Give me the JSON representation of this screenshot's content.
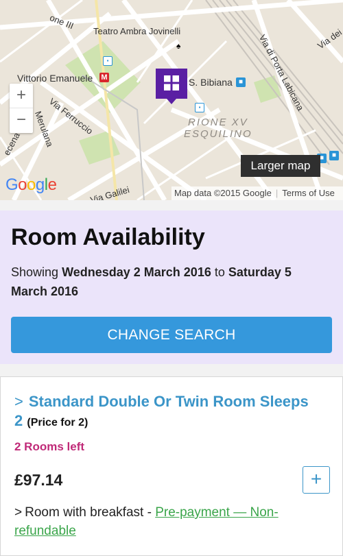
{
  "map": {
    "labels": {
      "teatro": "Teatro Ambra Jovinelli",
      "vittorio": "Vittorio Emanuele",
      "bibiana": "S. Bibiana",
      "ferruccio": "Via Ferruccio",
      "merulana": "Merulana",
      "galilei": "Via Galilei",
      "porta": "Via di Porta Labicana",
      "viadei": "Via dei",
      "one_iii": "one III",
      "mecena": "ecena",
      "district": "RIONE XV\nESQUILINO"
    },
    "zoom_in": "+",
    "zoom_out": "−",
    "larger_map": "Larger map",
    "logo": "Google",
    "map_data": "Map data ©2015 Google",
    "terms": "Terms of Use",
    "metro_glyph": "M",
    "colors": {
      "hotel_pin": "#5a1fa3",
      "metro": "#d8262d",
      "transit": "#2a94d6"
    }
  },
  "availability": {
    "title": "Room Availability",
    "showing_prefix": "Showing",
    "from_date": "Wednesday 2 March 2016",
    "connector": "to",
    "to_date": "Saturday 5 March 2016",
    "change_search": "CHANGE SEARCH",
    "colors": {
      "background": "#ebe4fa",
      "button": "#3598dc"
    }
  },
  "room": {
    "chevron": ">",
    "name": "Standard Double Or Twin Room Sleeps 2",
    "price_for": "(Price for 2)",
    "rooms_left": "2 Rooms left",
    "price": "£97.14",
    "add_label": "+",
    "rate_chevron": ">",
    "rate_name": "Room with breakfast - ",
    "rate_policy": "Pre-payment — Non-refundable",
    "colors": {
      "title": "#3b95c8",
      "rooms_left": "#c02a78",
      "policy": "#3aa54a"
    }
  }
}
